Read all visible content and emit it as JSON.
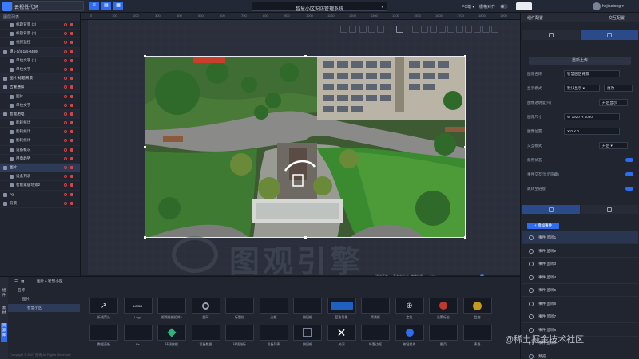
{
  "header": {
    "app_title": "云视低代码",
    "project_title": "智慧小区安防管理系统",
    "pc_mode": "PC端 ▾",
    "grid_label": "栅格对齐",
    "user_name": "hejiaotong ▾"
  },
  "left_panel": {
    "title": "图层列表",
    "items": [
      {
        "label": "标题背景 (2)",
        "indent": 1,
        "group": false
      },
      {
        "label": "标题背景 (3)",
        "indent": 1,
        "group": false
      },
      {
        "label": "视频监控",
        "indent": 1,
        "group": false
      },
      {
        "label": "组1-1/4-1/4-0409",
        "indent": 0,
        "group": true
      },
      {
        "label": "单位文字 (1)",
        "indent": 1,
        "group": false
      },
      {
        "label": "单位文字",
        "indent": 1,
        "group": false
      },
      {
        "label": "图片-标题背景",
        "indent": 0,
        "group": true
      },
      {
        "label": "告警通知",
        "indent": 0,
        "group": true
      },
      {
        "label": "图片",
        "indent": 1,
        "group": false
      },
      {
        "label": "单位文字",
        "indent": 1,
        "group": false
      },
      {
        "label": "智能用电",
        "indent": 0,
        "group": true
      },
      {
        "label": "能耗统计",
        "indent": 1,
        "group": false
      },
      {
        "label": "能耗统计",
        "indent": 1,
        "group": false
      },
      {
        "label": "能耗统计",
        "indent": 1,
        "group": false
      },
      {
        "label": "设备概况",
        "indent": 1,
        "group": false
      },
      {
        "label": "用电趋势",
        "indent": 1,
        "group": false
      },
      {
        "label": "图片",
        "indent": 0,
        "group": true,
        "active": true
      },
      {
        "label": "设备列表",
        "indent": 1,
        "group": false
      },
      {
        "label": "智能家居场景2",
        "indent": 1,
        "group": false
      },
      {
        "label": "bg",
        "indent": 0,
        "group": false
      },
      {
        "label": "背景",
        "indent": 0,
        "group": false
      }
    ]
  },
  "ruler": {
    "marks": [
      "0",
      "100",
      "200",
      "300",
      "400",
      "500",
      "600",
      "700",
      "800",
      "900",
      "1000",
      "1100",
      "1200",
      "1300",
      "1400",
      "1500",
      "1600",
      "1700",
      "1800",
      "1900"
    ]
  },
  "watermark": {
    "text": "图观引擎"
  },
  "zoom_bar": {
    "fit": "适应画布",
    "label": "画布大小(1) 缩放比例",
    "zoom": "50%"
  },
  "right_panel": {
    "head_left": "组件配置",
    "head_right": "交互配置",
    "upload_btn": "重新上传",
    "props": [
      {
        "label": "图像名称",
        "value": "智慧园区背景"
      },
      {
        "label": "显示模式",
        "value": "默认显示 ▾",
        "extra": "更改"
      },
      {
        "label": "图像透明度(%)",
        "value": "",
        "extra": "开启显示"
      },
      {
        "label": "图像尺寸",
        "value": "W  1920        H  1080"
      },
      {
        "label": "图像位置",
        "value": "X  0          Y  0"
      },
      {
        "label": "交互模式",
        "value": "",
        "extra": "开启 ▾"
      },
      {
        "label": "禁用状态",
        "value": "",
        "switch": true
      },
      {
        "label": "事件交互(显示隐藏)",
        "value": "",
        "switch": true
      },
      {
        "label": "跳转至链接",
        "value": "",
        "switch": true
      }
    ],
    "add_event": "+ 添加事件",
    "events": [
      "事件 监听1",
      "事件 监听2",
      "事件 监听3",
      "事件 监听4",
      "事件 监听5",
      "事件 监听6",
      "事件 监听7",
      "事件 监听8",
      "事件 监听9",
      "预览"
    ]
  },
  "bottom_panel": {
    "side_tabs": [
      "组件",
      "素材",
      "资源库"
    ],
    "breadcrumb": "图片 ▸ 智慧小区",
    "tree": [
      "名称",
      "图片",
      "智慧小区"
    ],
    "components": [
      {
        "label": "折线箭头",
        "icon": "arrow-icon"
      },
      {
        "label": "Logo",
        "icon": "logo-icon"
      },
      {
        "label": "视频轮播组件1",
        "icon": "panel-icon"
      },
      {
        "label": "圆环",
        "icon": "ring-icon"
      },
      {
        "label": "标题栏",
        "icon": "title-icon"
      },
      {
        "label": "边框",
        "icon": "frame-icon"
      },
      {
        "label": "按钮框",
        "icon": "button-frame-icon"
      },
      {
        "label": "蓝色背景",
        "icon": "blue-bg-icon"
      },
      {
        "label": "背景框",
        "icon": "bg-frame-icon"
      },
      {
        "label": "定位",
        "icon": "target-icon"
      },
      {
        "label": "告警标志",
        "icon": "alert-icon"
      },
      {
        "label": "监控",
        "icon": "camera-icon"
      },
      {
        "label": "数据面板",
        "icon": "data-panel-icon"
      },
      {
        "label": "Bs",
        "icon": "bs-icon"
      },
      {
        "label": "环境数据",
        "icon": "diamond-icon"
      },
      {
        "label": "设备数据",
        "icon": "device-icon"
      },
      {
        "label": "环境指标",
        "icon": "env-icon"
      },
      {
        "label": "设备列表",
        "icon": "list-icon"
      },
      {
        "label": "按钮框",
        "icon": "box-icon"
      },
      {
        "label": "关闭",
        "icon": "close-icon"
      },
      {
        "label": "标题边框",
        "icon": "title-frame-icon"
      },
      {
        "label": "按钮组件",
        "icon": "button-icon"
      },
      {
        "label": "翻页",
        "icon": "pager-icon"
      },
      {
        "label": "表格",
        "icon": "table-icon"
      }
    ]
  },
  "footer": {
    "text": "Copyright © 2021 图观 All Rights Reserved"
  },
  "credit": {
    "text": "@稀土掘金技术社区"
  }
}
